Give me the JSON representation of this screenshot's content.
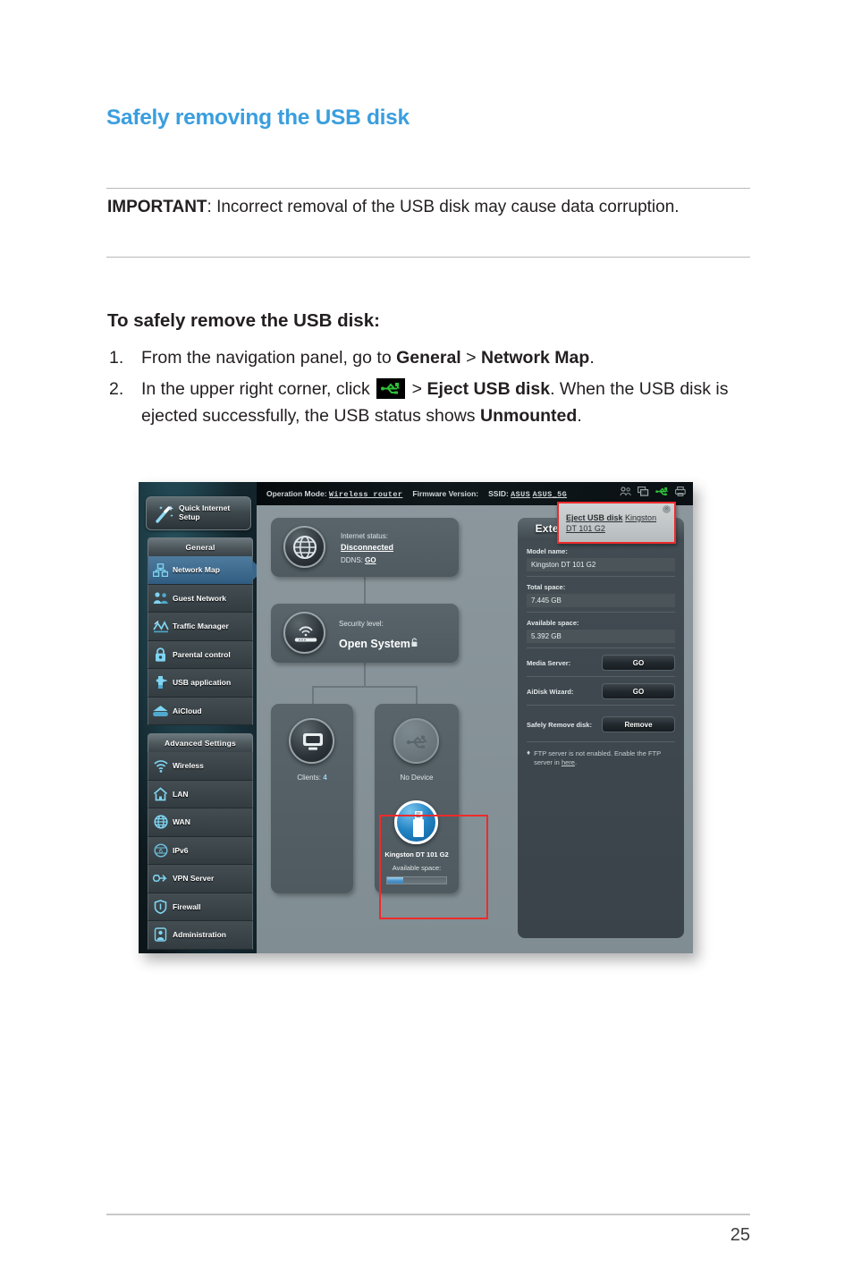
{
  "document": {
    "heading": "Safely removing the USB disk",
    "important_label": "IMPORTANT",
    "important_text": ":  Incorrect removal of the USB disk may cause data corruption.",
    "howto_title": "To safely remove the USB disk:",
    "steps": [
      {
        "num": "1.",
        "parts": [
          "From the navigation panel, go to ",
          "General",
          " > ",
          "Network Map",
          "."
        ]
      },
      {
        "num": "2.",
        "parts": [
          "In the upper right corner, click ",
          "usb-icon",
          " > ",
          "Eject USB disk",
          ". When the USB disk is ejected successfully, the USB status shows ",
          "Unmounted",
          "."
        ]
      }
    ],
    "page_number": "25",
    "accent_color": "#3a9ede"
  },
  "router_ui": {
    "topbar": {
      "operation_mode_label": "Operation Mode:",
      "operation_mode_value": "Wireless router",
      "firmware_label": "Firmware Version:",
      "firmware_value": "",
      "ssid_label": "SSID:",
      "ssid_1": "ASUS",
      "ssid_2": "ASUS_5G",
      "icons": [
        "guest-users-icon",
        "client-monitor-icon",
        "usb-icon",
        "printer-icon"
      ],
      "usb_icon_color": "#2fc03a"
    },
    "tooltip": {
      "action": "Eject USB disk",
      "device": "Kingston DT 101 G2",
      "close": "×"
    },
    "sidebar": {
      "quick_setup": "Quick Internet Setup",
      "groups": [
        {
          "header": "General",
          "items": [
            {
              "label": "Network Map",
              "icon": "network-map-icon",
              "active": true
            },
            {
              "label": "Guest Network",
              "icon": "guest-network-icon",
              "active": false
            },
            {
              "label": "Traffic Manager",
              "icon": "traffic-manager-icon",
              "active": false
            },
            {
              "label": "Parental control",
              "icon": "parental-control-icon",
              "active": false
            },
            {
              "label": "USB application",
              "icon": "usb-application-icon",
              "active": false
            },
            {
              "label": "AiCloud",
              "icon": "aicloud-icon",
              "active": false
            }
          ]
        },
        {
          "header": "Advanced Settings",
          "items": [
            {
              "label": "Wireless",
              "icon": "wireless-icon",
              "active": false
            },
            {
              "label": "LAN",
              "icon": "lan-icon",
              "active": false
            },
            {
              "label": "WAN",
              "icon": "wan-icon",
              "active": false
            },
            {
              "label": "IPv6",
              "icon": "ipv6-icon",
              "active": false
            },
            {
              "label": "VPN Server",
              "icon": "vpn-server-icon",
              "active": false
            },
            {
              "label": "Firewall",
              "icon": "firewall-icon",
              "active": false
            },
            {
              "label": "Administration",
              "icon": "administration-icon",
              "active": false
            }
          ]
        }
      ]
    },
    "network_map": {
      "internet": {
        "status_label": "Internet status:",
        "status_value": "Disconnected",
        "ddns_label": "DDNS:",
        "ddns_link": "GO"
      },
      "security": {
        "label": "Security level:",
        "value": "Open System",
        "lock_icon": "unlock-icon"
      },
      "clients": {
        "label": "Clients:",
        "count": "4"
      },
      "no_device": {
        "label": "No Device"
      },
      "usb_device": {
        "name": "Kingston DT 101 G2",
        "space_label": "Available space:",
        "fill_percent": 28
      }
    },
    "usb_status_panel": {
      "title": "External USB disk status",
      "fields": [
        {
          "label": "Model name:",
          "value": "Kingston DT 101 G2"
        },
        {
          "label": "Total space:",
          "value": "7.445 GB"
        },
        {
          "label": "Available space:",
          "value": "5.392 GB"
        }
      ],
      "actions": [
        {
          "label": "Media Server:",
          "button": "GO"
        },
        {
          "label": "AiDisk Wizard:",
          "button": "GO"
        },
        {
          "label": "Safely Remove disk:",
          "button": "Remove"
        }
      ],
      "note_bullet": "♦",
      "note_text_pre": "FTP server is not enabled. Enable the FTP server in ",
      "note_link": "here",
      "note_text_post": "."
    }
  }
}
